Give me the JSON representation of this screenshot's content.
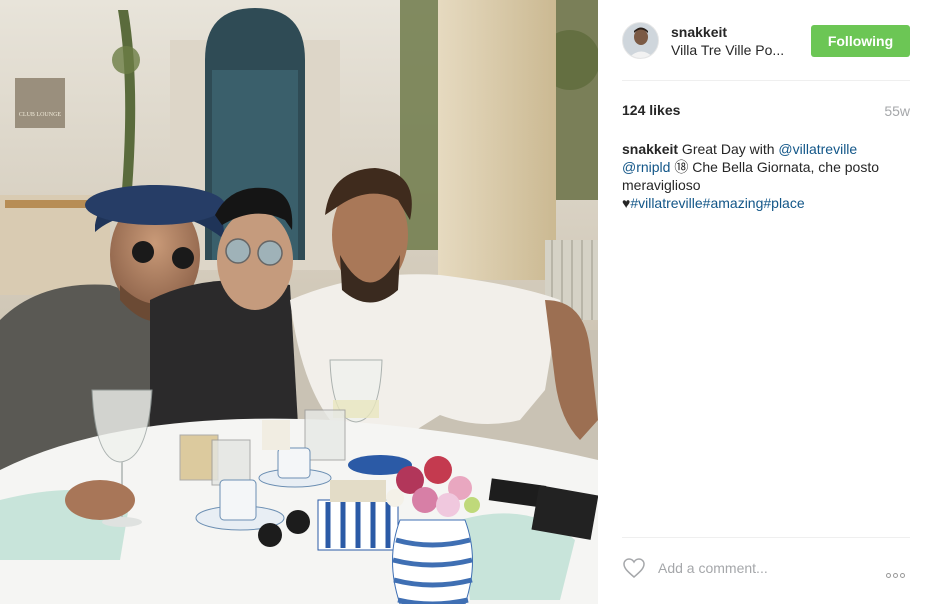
{
  "post": {
    "photo_alt": "",
    "sign_text": "CLUB LOUNGE"
  },
  "header": {
    "username": "snakkeit",
    "location": "Villa Tre Ville Po...",
    "follow_label": "Following"
  },
  "stats": {
    "likes": "124 likes",
    "age": "55w"
  },
  "caption": {
    "user": "snakkeit",
    "text_1": " Great Day with ",
    "mention_1": "@villatreville",
    "mention_2": "@rnipld",
    "text_2": " ⑱ Che Bella Giornata, che posto meraviglioso",
    "heart": "♥",
    "tag_1": "#villatreville",
    "tag_2": "#amazing",
    "tag_3": "#place"
  },
  "comment": {
    "placeholder": "Add a comment..."
  },
  "colors": {
    "follow_bg": "#6cc655",
    "link": "#125688",
    "muted": "#a5a7aa"
  },
  "icons": {
    "like": "heart-outline-icon",
    "more": "ellipsis-icon"
  }
}
